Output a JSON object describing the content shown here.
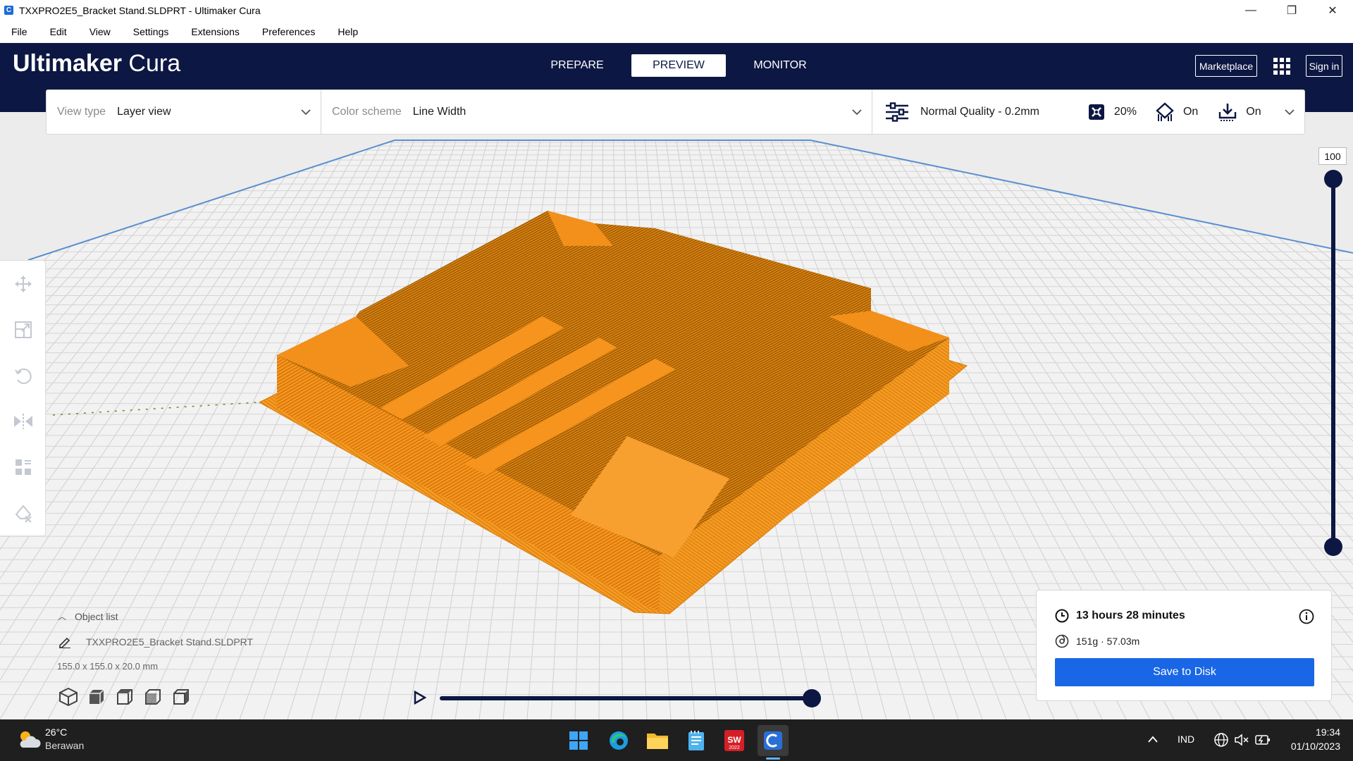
{
  "window": {
    "title": "TXXPRO2E5_Bracket Stand.SLDPRT - Ultimaker Cura",
    "app_icon": "C",
    "minimize": "—",
    "maximize": "❐",
    "close": "✕"
  },
  "menu": [
    "File",
    "Edit",
    "View",
    "Settings",
    "Extensions",
    "Preferences",
    "Help"
  ],
  "header": {
    "brand_bold": "Ultimaker",
    "brand_light": "Cura",
    "tabs": [
      {
        "label": "PREPARE"
      },
      {
        "label": "PREVIEW"
      },
      {
        "label": "MONITOR"
      }
    ],
    "marketplace_label": "Marketplace",
    "signin_label": "Sign in"
  },
  "toolbar": {
    "view_type_label": "View type",
    "view_type_value": "Layer view",
    "color_scheme_label": "Color scheme",
    "color_scheme_value": "Line Width",
    "quality": "Normal Quality - 0.2mm",
    "infill": "20%",
    "support": "On",
    "adhesion": "On"
  },
  "layer_slider": {
    "value": "100"
  },
  "object_list": {
    "title": "Object list",
    "file": "TXXPRO2E5_Bracket Stand.SLDPRT",
    "dimensions": "155.0 x 155.0 x 20.0 mm"
  },
  "print_info": {
    "time": "13 hours 28 minutes",
    "material": "151g · 57.03m",
    "save_label": "Save to Disk"
  },
  "taskbar": {
    "temperature": "26°C",
    "weather": "Berawan",
    "language": "IND",
    "time": "19:34",
    "date": "01/10/2023",
    "sw_label": "SW",
    "sw_year": "2022"
  },
  "colors": {
    "header": "#0d1743",
    "accent": "#1966e6",
    "model": "#f5961e"
  }
}
